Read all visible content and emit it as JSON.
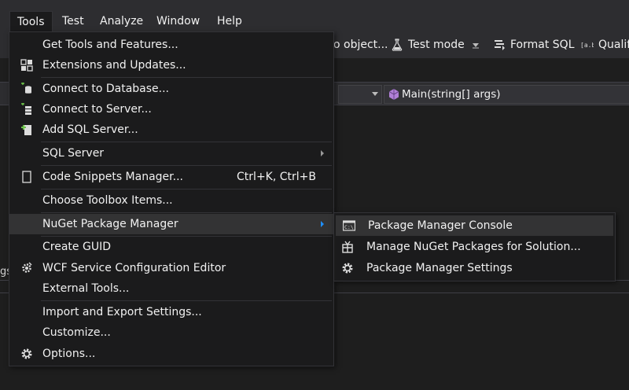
{
  "menubar": {
    "items": [
      {
        "label": "Tools"
      },
      {
        "label": "Test"
      },
      {
        "label": "Analyze"
      },
      {
        "label": "Window"
      },
      {
        "label": "Help"
      }
    ]
  },
  "toolbar": {
    "go_object": "o object...",
    "test_mode": "Test mode",
    "format_sql": "Format SQL",
    "qualify": "Qualif"
  },
  "nav": {
    "member_combo": "Main(string[] args)"
  },
  "left_fragment": "gs",
  "tools_menu": {
    "items": [
      {
        "label": "Get Tools and Features...",
        "icon": "none"
      },
      {
        "label": "Extensions and Updates...",
        "icon": "extensions-icon"
      },
      {
        "label": "Connect to Database...",
        "icon": "database-connect-icon"
      },
      {
        "label": "Connect to Server...",
        "icon": "server-connect-icon"
      },
      {
        "label": "Add SQL Server...",
        "icon": "add-sql-server-icon"
      },
      {
        "label": "SQL Server",
        "icon": "none"
      },
      {
        "label": "Code Snippets Manager...",
        "icon": "snippets-icon",
        "shortcut": "Ctrl+K, Ctrl+B"
      },
      {
        "label": "Choose Toolbox Items...",
        "icon": "none"
      },
      {
        "label": "NuGet Package Manager",
        "icon": "none"
      },
      {
        "label": "Create GUID",
        "icon": "none"
      },
      {
        "label": "WCF Service Configuration Editor",
        "icon": "wcf-gear-icon"
      },
      {
        "label": "External Tools...",
        "icon": "none"
      },
      {
        "label": "Import and Export Settings...",
        "icon": "none"
      },
      {
        "label": "Customize...",
        "icon": "none"
      },
      {
        "label": "Options...",
        "icon": "gear-icon"
      }
    ]
  },
  "nuget_submenu": {
    "items": [
      {
        "label": "Package Manager Console",
        "icon": "console-icon"
      },
      {
        "label": "Manage NuGet Packages for Solution...",
        "icon": "package-icon"
      },
      {
        "label": "Package Manager Settings",
        "icon": "gear-icon"
      }
    ]
  },
  "colors": {
    "menu_bg": "#1b1b1c",
    "highlight": "#333334",
    "accent": "#1e90ff",
    "chrome": "#2d2d30"
  }
}
